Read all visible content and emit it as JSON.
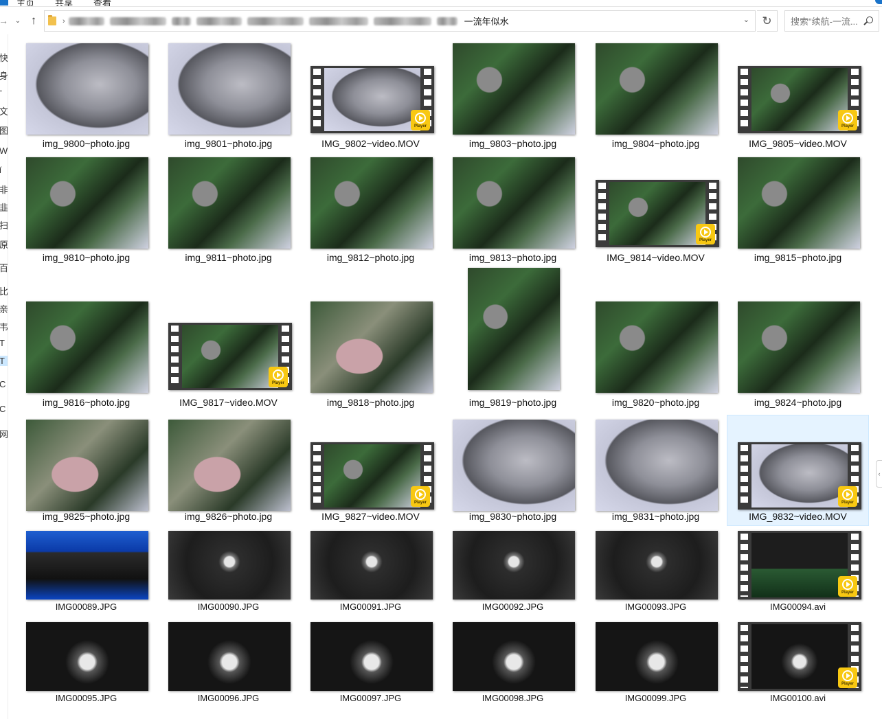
{
  "ribbon": {
    "items": [
      "主页",
      "共享",
      "查看"
    ]
  },
  "address": {
    "last_segment": "一流年似水",
    "separator": "›"
  },
  "search": {
    "placeholder": "搜索\"续航-一流..."
  },
  "nav_pane": {
    "chars": [
      "快",
      "身",
      "-",
      "文",
      "图",
      "W",
      "ǐ",
      "非",
      "韭",
      "扫",
      "原",
      "百",
      "比",
      "亲",
      "韦",
      "T",
      "T",
      "C",
      "C",
      "网"
    ]
  },
  "files": [
    {
      "name": "img_9800~photo.jpg",
      "type": "photo",
      "style": "ph-console"
    },
    {
      "name": "img_9801~photo.jpg",
      "type": "photo",
      "style": "ph-console"
    },
    {
      "name": "IMG_9802~video.MOV",
      "type": "video",
      "style": "ph-console"
    },
    {
      "name": "img_9803~photo.jpg",
      "type": "photo",
      "style": "ph-board"
    },
    {
      "name": "img_9804~photo.jpg",
      "type": "photo",
      "style": "ph-board"
    },
    {
      "name": "IMG_9805~video.MOV",
      "type": "video",
      "style": "ph-board"
    },
    {
      "name": "img_9810~photo.jpg",
      "type": "photo",
      "style": "ph-board"
    },
    {
      "name": "img_9811~photo.jpg",
      "type": "photo",
      "style": "ph-board"
    },
    {
      "name": "img_9812~photo.jpg",
      "type": "photo",
      "style": "ph-board"
    },
    {
      "name": "img_9813~photo.jpg",
      "type": "photo",
      "style": "ph-board"
    },
    {
      "name": "IMG_9814~video.MOV",
      "type": "video",
      "style": "ph-board"
    },
    {
      "name": "img_9815~photo.jpg",
      "type": "photo",
      "style": "ph-board"
    },
    {
      "name": "img_9816~photo.jpg",
      "type": "photo",
      "style": "ph-board"
    },
    {
      "name": "IMG_9817~video.MOV",
      "type": "video",
      "style": "ph-board"
    },
    {
      "name": "img_9818~photo.jpg",
      "type": "photo",
      "style": "ph-pink"
    },
    {
      "name": "img_9819~photo.jpg",
      "type": "photo",
      "style": "ph-board"
    },
    {
      "name": "img_9820~photo.jpg",
      "type": "photo",
      "style": "ph-board"
    },
    {
      "name": "img_9824~photo.jpg",
      "type": "photo",
      "style": "ph-board"
    },
    {
      "name": "img_9825~photo.jpg",
      "type": "photo",
      "style": "ph-pink"
    },
    {
      "name": "img_9826~photo.jpg",
      "type": "photo",
      "style": "ph-pink"
    },
    {
      "name": "IMG_9827~video.MOV",
      "type": "video",
      "style": "ph-board"
    },
    {
      "name": "img_9830~photo.jpg",
      "type": "photo",
      "style": "ph-console"
    },
    {
      "name": "img_9831~photo.jpg",
      "type": "photo",
      "style": "ph-console"
    },
    {
      "name": "IMG_9832~video.MOV",
      "type": "video",
      "style": "ph-console",
      "selected": true
    },
    {
      "name": "IMG00089.JPG",
      "type": "photo",
      "style": "ph-closeup-blue"
    },
    {
      "name": "IMG00090.JPG",
      "type": "photo",
      "style": "ph-closeup-dark"
    },
    {
      "name": "IMG00091.JPG",
      "type": "photo",
      "style": "ph-closeup-dark"
    },
    {
      "name": "IMG00092.JPG",
      "type": "photo",
      "style": "ph-closeup-dark"
    },
    {
      "name": "IMG00093.JPG",
      "type": "photo",
      "style": "ph-closeup-dark"
    },
    {
      "name": "IMG00094.avi",
      "type": "video",
      "style": "ph-closeup-green"
    },
    {
      "name": "IMG00095.JPG",
      "type": "photo",
      "style": "ph-sp"
    },
    {
      "name": "IMG00096.JPG",
      "type": "photo",
      "style": "ph-sp"
    },
    {
      "name": "IMG00097.JPG",
      "type": "photo",
      "style": "ph-sp"
    },
    {
      "name": "IMG00098.JPG",
      "type": "photo",
      "style": "ph-sp"
    },
    {
      "name": "IMG00099.JPG",
      "type": "photo",
      "style": "ph-sp"
    },
    {
      "name": "IMG00100.avi",
      "type": "video",
      "style": "ph-sp"
    }
  ],
  "player_badge_text": "Player",
  "colors": {
    "selection": "#e5f3ff",
    "badge": "#f8c812",
    "accent": "#1a73c9"
  }
}
